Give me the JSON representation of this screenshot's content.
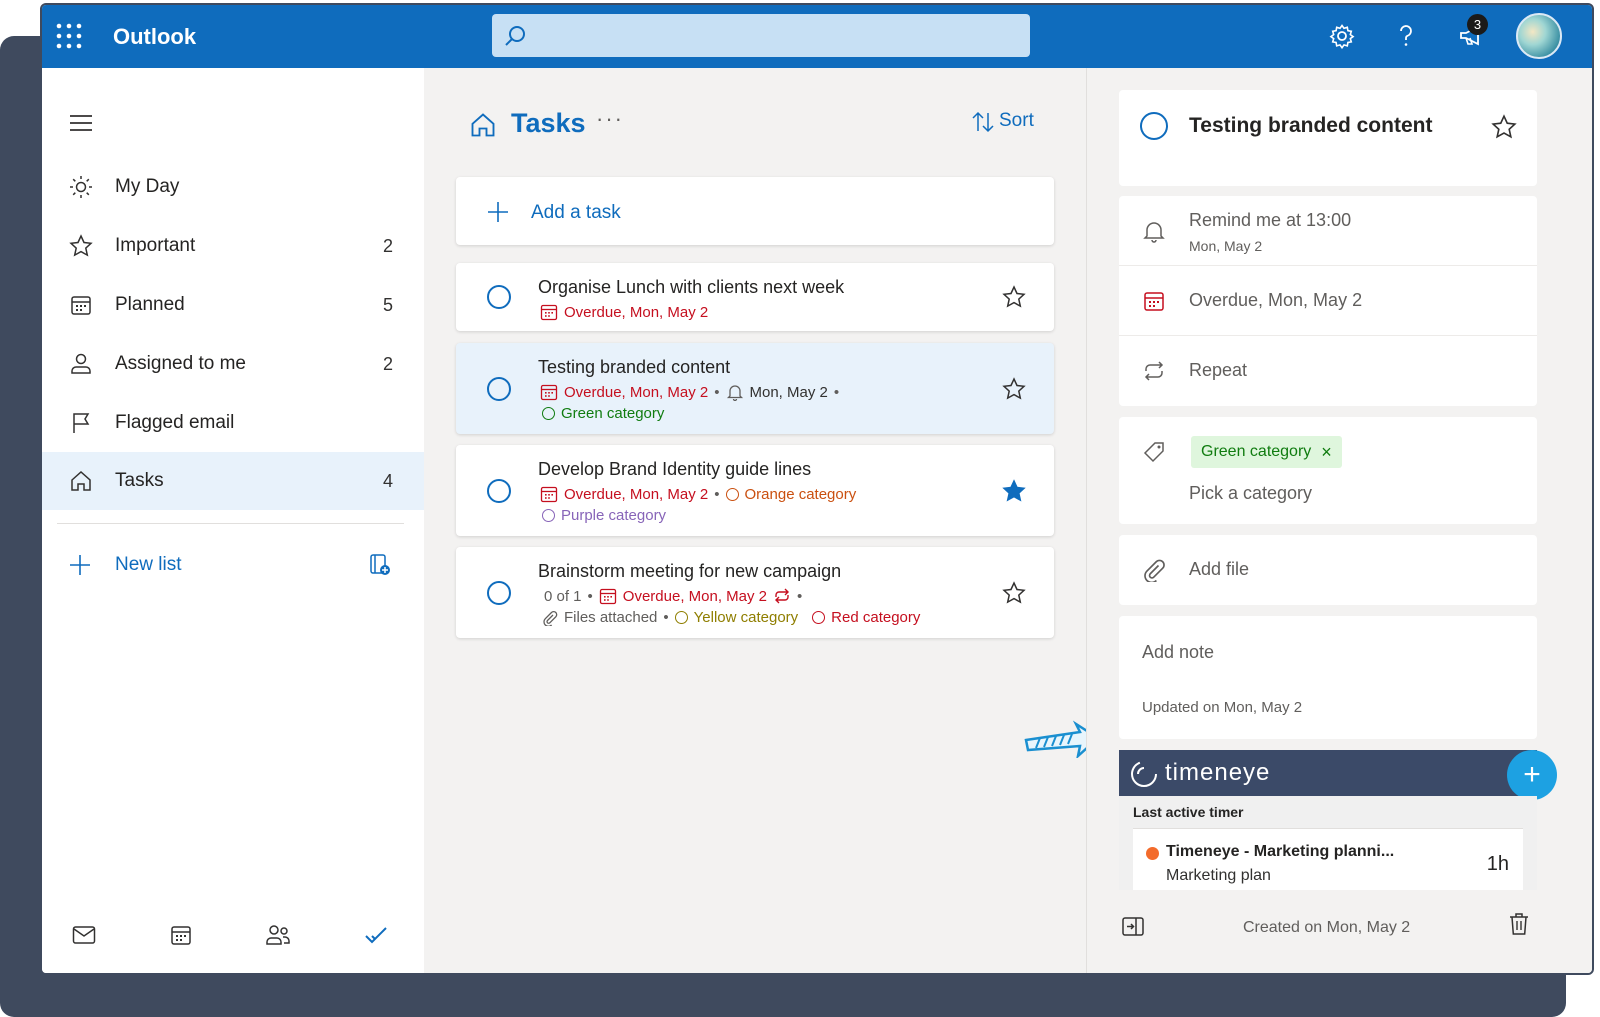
{
  "topbar": {
    "app_name": "Outlook",
    "search_placeholder": "",
    "notification_count": "3"
  },
  "sidebar": {
    "items": [
      {
        "label": "My Day",
        "count": ""
      },
      {
        "label": "Important",
        "count": "2"
      },
      {
        "label": "Planned",
        "count": "5"
      },
      {
        "label": "Assigned to me",
        "count": "2"
      },
      {
        "label": "Flagged email",
        "count": ""
      },
      {
        "label": "Tasks",
        "count": "4"
      }
    ],
    "new_list_label": "New list"
  },
  "middle": {
    "title": "Tasks",
    "more": "···",
    "sort_label": "Sort",
    "add_task_label": "Add a task",
    "tasks": [
      {
        "title": "Organise Lunch with clients next week",
        "due": "Overdue, Mon, May 2",
        "starred": false
      },
      {
        "title": "Testing branded content",
        "due": "Overdue, Mon, May 2",
        "reminder": "Mon, May 2",
        "category": "Green category",
        "starred": false
      },
      {
        "title": "Develop Brand Identity guide lines",
        "due": "Overdue, Mon, May 2",
        "category": "Orange category",
        "category2": "Purple category",
        "starred": true
      },
      {
        "title": "Brainstorm meeting for new campaign",
        "steps": "0 of 1",
        "due": "Overdue, Mon, May 2",
        "files": "Files attached",
        "category": "Yellow category",
        "category2": "Red category",
        "starred": false
      }
    ]
  },
  "detail": {
    "title": "Testing branded content",
    "remind": "Remind me at 13:00",
    "remind_date": "Mon, May 2",
    "due": "Overdue, Mon, May 2",
    "repeat": "Repeat",
    "category_chip": "Green category",
    "pick_category": "Pick a category",
    "add_file": "Add file",
    "add_note": "Add note",
    "updated": "Updated on Mon, May 2",
    "created": "Created on Mon, May 2"
  },
  "timeneye": {
    "brand": "timeneye",
    "last_active_label": "Last active timer",
    "timer_title": "Timeneye - Marketing planni...",
    "timer_project": "Marketing plan",
    "timer_duration": "1h"
  },
  "colors": {
    "accent": "#0f6cbd",
    "overdue": "#c50f1f",
    "timeneye_header": "#3b4a68",
    "fab": "#1da1e2"
  }
}
